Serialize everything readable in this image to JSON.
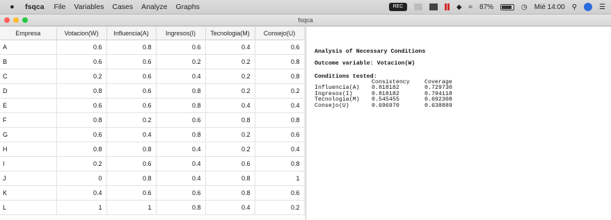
{
  "menubar": {
    "app_name": "fsqca",
    "menus": [
      "File",
      "Variables",
      "Cases",
      "Analyze",
      "Graphs"
    ],
    "camera_label": "REC",
    "battery_pct": "87%",
    "clock": "Mié 14:00"
  },
  "window": {
    "title": "fsqca"
  },
  "grid": {
    "columns": [
      "Empresa",
      "Votacion(W)",
      "Influencia(A)",
      "Ingresos(I)",
      "Tecnologia(M)",
      "Consejo(U)"
    ],
    "rows": [
      [
        "A",
        "0.6",
        "0.8",
        "0.6",
        "0.4",
        "0.6"
      ],
      [
        "B",
        "0.6",
        "0.6",
        "0.2",
        "0.2",
        "0.8"
      ],
      [
        "C",
        "0.2",
        "0.6",
        "0.4",
        "0.2",
        "0.8"
      ],
      [
        "D",
        "0.8",
        "0.6",
        "0.8",
        "0.2",
        "0.2"
      ],
      [
        "E",
        "0.6",
        "0.6",
        "0.8",
        "0.4",
        "0.4"
      ],
      [
        "F",
        "0.8",
        "0.2",
        "0.6",
        "0.8",
        "0.8"
      ],
      [
        "G",
        "0.6",
        "0.4",
        "0.8",
        "0.2",
        "0.6"
      ],
      [
        "H",
        "0.8",
        "0.8",
        "0.4",
        "0.2",
        "0.4"
      ],
      [
        "I",
        "0.2",
        "0.6",
        "0.4",
        "0.6",
        "0.8"
      ],
      [
        "J",
        "0",
        "0.8",
        "0.4",
        "0.8",
        "1"
      ],
      [
        "K",
        "0.4",
        "0.6",
        "0.6",
        "0.8",
        "0.6"
      ],
      [
        "L",
        "1",
        "1",
        "0.8",
        "0.4",
        "0.2"
      ]
    ]
  },
  "output": {
    "heading": "Analysis of Necessary Conditions",
    "outcome": "Outcome variable: Votacion(W)",
    "tested_label": "Conditions tested:",
    "col_consistency": "Consistency",
    "col_coverage": "Coverage",
    "conditions": [
      {
        "name": "Influencia(A)",
        "consistency": "0.818182",
        "coverage": "0.729730"
      },
      {
        "name": "Ingresos(I)",
        "consistency": "0.818182",
        "coverage": "0.794118"
      },
      {
        "name": "Tecnologia(M)",
        "consistency": "0.545455",
        "coverage": "0.692308"
      },
      {
        "name": "Consejo(U)",
        "consistency": "0.696970",
        "coverage": "0.638889"
      }
    ]
  }
}
